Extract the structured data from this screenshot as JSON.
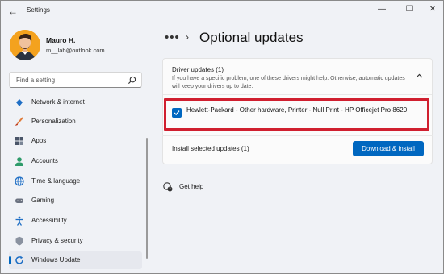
{
  "window": {
    "title": "Settings",
    "back_glyph": "←",
    "minimize_glyph": "—",
    "maximize_glyph": "☐",
    "close_glyph": "✕"
  },
  "profile": {
    "name": "Mauro H.",
    "email": "m__lab@outlook.com"
  },
  "search": {
    "placeholder": "Find a setting",
    "icon": "search-icon"
  },
  "sidebar": {
    "items": [
      {
        "label": "Network & internet",
        "icon": "wifi-icon",
        "color": "#1f6fc5"
      },
      {
        "label": "Personalization",
        "icon": "brush-icon",
        "color": "#e07b39"
      },
      {
        "label": "Apps",
        "icon": "apps-icon",
        "color": "#4a5568"
      },
      {
        "label": "Accounts",
        "icon": "person-icon",
        "color": "#2e9b6a"
      },
      {
        "label": "Time & language",
        "icon": "globe-clock-icon",
        "color": "#1f6fc5"
      },
      {
        "label": "Gaming",
        "icon": "gamepad-icon",
        "color": "#6b7280"
      },
      {
        "label": "Accessibility",
        "icon": "accessibility-icon",
        "color": "#1f6fc5"
      },
      {
        "label": "Privacy & security",
        "icon": "shield-icon",
        "color": "#6b7280"
      },
      {
        "label": "Windows Update",
        "icon": "update-icon",
        "color": "#1f6fc5",
        "active": true
      }
    ]
  },
  "breadcrumb": {
    "overflow": "•••",
    "separator": "›"
  },
  "main": {
    "title": "Optional updates",
    "driver_section": {
      "title": "Driver updates (1)",
      "description": "If you have a specific problem, one of these drivers might help. Otherwise, automatic updates will keep your drivers up to date.",
      "expanded": true
    },
    "driver_item": {
      "checked": true,
      "label": "Hewlett-Packard  - Other hardware, Printer - Null Print - HP Officejet Pro 8620"
    },
    "install": {
      "label": "Install selected updates (1)",
      "button": "Download & install"
    },
    "help": {
      "label": "Get help"
    }
  },
  "colors": {
    "accent": "#0067c0",
    "highlight_border": "#d01f2f",
    "avatar_bg": "#f4a21e"
  }
}
